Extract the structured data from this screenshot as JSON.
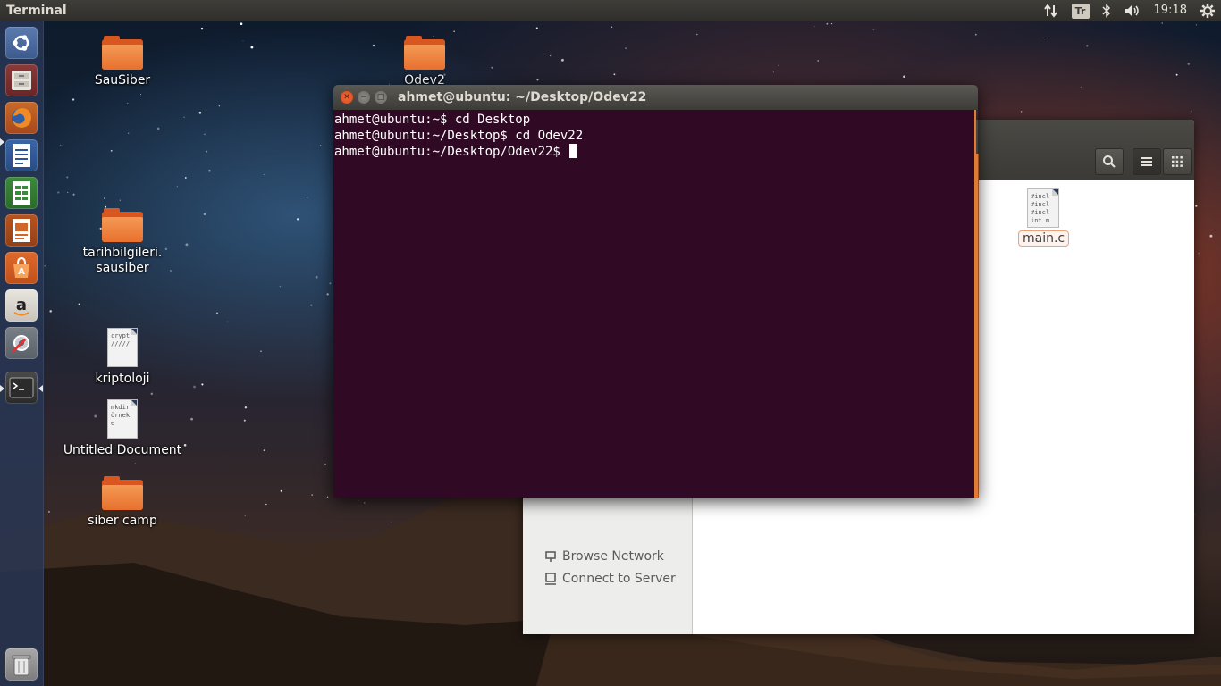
{
  "top_panel": {
    "app_title": "Terminal",
    "keyboard_layout": "Tr",
    "clock": "19:18",
    "icons": [
      "network-updown-icon",
      "keyboard-layout-indicator",
      "bluetooth-icon",
      "volume-icon",
      "power-gear-icon"
    ]
  },
  "launcher": {
    "items": [
      {
        "name": "dash-home",
        "icon": "ubuntu-logo-icon"
      },
      {
        "name": "files",
        "icon": "file-cabinet-icon"
      },
      {
        "name": "firefox",
        "icon": "firefox-icon"
      },
      {
        "name": "libreoffice-writer",
        "icon": "writer-icon"
      },
      {
        "name": "libreoffice-calc",
        "icon": "calc-icon"
      },
      {
        "name": "libreoffice-impress",
        "icon": "impress-icon"
      },
      {
        "name": "software-center",
        "icon": "shopping-bag-icon"
      },
      {
        "name": "amazon",
        "icon": "amazon-icon"
      },
      {
        "name": "system-settings",
        "icon": "settings-wrench-icon"
      },
      {
        "name": "terminal",
        "icon": "terminal-icon"
      },
      {
        "name": "trash",
        "icon": "trash-icon"
      }
    ]
  },
  "desktop": {
    "icons": [
      {
        "label": "SauSiber",
        "type": "folder"
      },
      {
        "label": "Odev2",
        "type": "folder"
      },
      {
        "label": "tarihbilgileri.",
        "label2": "sausiber",
        "type": "folder"
      },
      {
        "label": "kriptoloji",
        "type": "document",
        "preview": "crypt\n/////"
      },
      {
        "label": "Untitled Document",
        "type": "document",
        "preview": "mkdir\nörnek\ne"
      },
      {
        "label": "siber camp",
        "type": "folder"
      }
    ]
  },
  "terminal": {
    "title": "ahmet@ubuntu: ~/Desktop/Odev22",
    "lines": [
      "ahmet@ubuntu:~$ cd Desktop",
      "ahmet@ubuntu:~/Desktop$ cd Odev22",
      "ahmet@ubuntu:~/Desktop/Odev22$ "
    ],
    "colors": {
      "background": "#300a24",
      "text": "#ffffff"
    }
  },
  "file_manager": {
    "sidebar": {
      "items": [
        {
          "label": "Browse Network",
          "icon": "network-icon"
        },
        {
          "label": "Connect to Server",
          "icon": "server-icon"
        }
      ]
    },
    "files": [
      {
        "name": "main.c",
        "preview": "#incl\n#incl\n#incl\nint m"
      }
    ],
    "toolbar_icons": [
      "search-icon",
      "list-view-icon",
      "grid-view-icon"
    ]
  },
  "colors": {
    "accent": "#e07a35",
    "panel": "#3c3b37"
  }
}
